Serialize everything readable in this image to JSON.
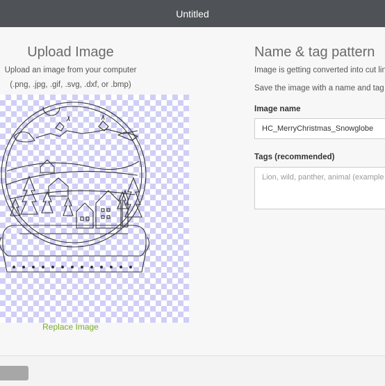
{
  "window": {
    "title": "Untitled"
  },
  "upload": {
    "title": "Upload Image",
    "line1": "Upload an image from your computer",
    "line2": "(.png, .jpg, .gif, .svg, .dxf, or .bmp)",
    "replace_label": "Replace Image"
  },
  "name_tag": {
    "title": "Name & tag pattern",
    "line1": "Image is getting converted into cut lin",
    "line2": "Save the image with a name and tag",
    "image_name_label": "Image name",
    "image_name_value": "HC_MerryChristmas_Snowglobe",
    "tags_label": "Tags (recommended)",
    "tags_placeholder": "Lion, wild, panther, animal (example"
  },
  "colors": {
    "titlebar": "#4f5256",
    "accent_link": "#7aaa2a",
    "checker": "#cfcff5"
  },
  "icons": {
    "preview": "snowglobe-image"
  }
}
